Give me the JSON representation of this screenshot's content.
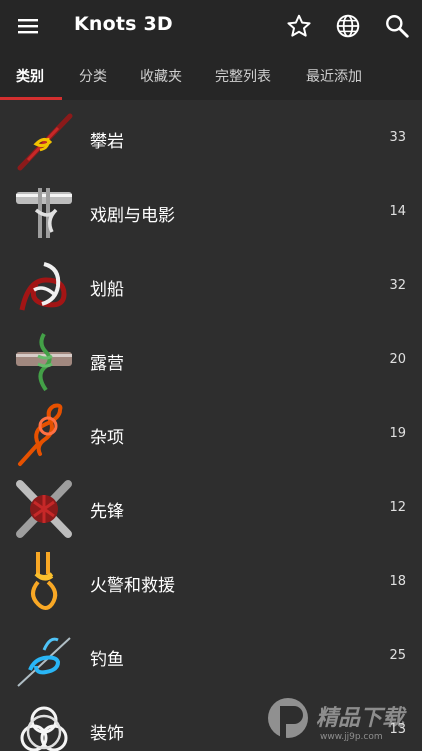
{
  "app": {
    "title": "Knots 3D"
  },
  "toolbar": {
    "menu_icon": "menu-icon",
    "star_icon": "star-icon",
    "globe_icon": "globe-icon",
    "search_icon": "search-icon"
  },
  "tabs": [
    {
      "label": "类别",
      "active": true
    },
    {
      "label": "分类",
      "active": false
    },
    {
      "label": "收藏夹",
      "active": false
    },
    {
      "label": "完整列表",
      "active": false
    },
    {
      "label": "最近添加",
      "active": false
    }
  ],
  "categories": [
    {
      "label": "攀岩",
      "count": "33"
    },
    {
      "label": "戏剧与电影",
      "count": "14"
    },
    {
      "label": "划船",
      "count": "32"
    },
    {
      "label": "露营",
      "count": "20"
    },
    {
      "label": "杂项",
      "count": "19"
    },
    {
      "label": "先锋",
      "count": "12"
    },
    {
      "label": "火警和救援",
      "count": "18"
    },
    {
      "label": "钓鱼",
      "count": "25"
    },
    {
      "label": "装饰",
      "count": "13"
    }
  ],
  "watermark": {
    "text": "精品下载",
    "url": "www.jj9p.com"
  },
  "colors": {
    "accent": "#d32f2f",
    "appbar": "#262626",
    "background": "#2e2e2e"
  }
}
